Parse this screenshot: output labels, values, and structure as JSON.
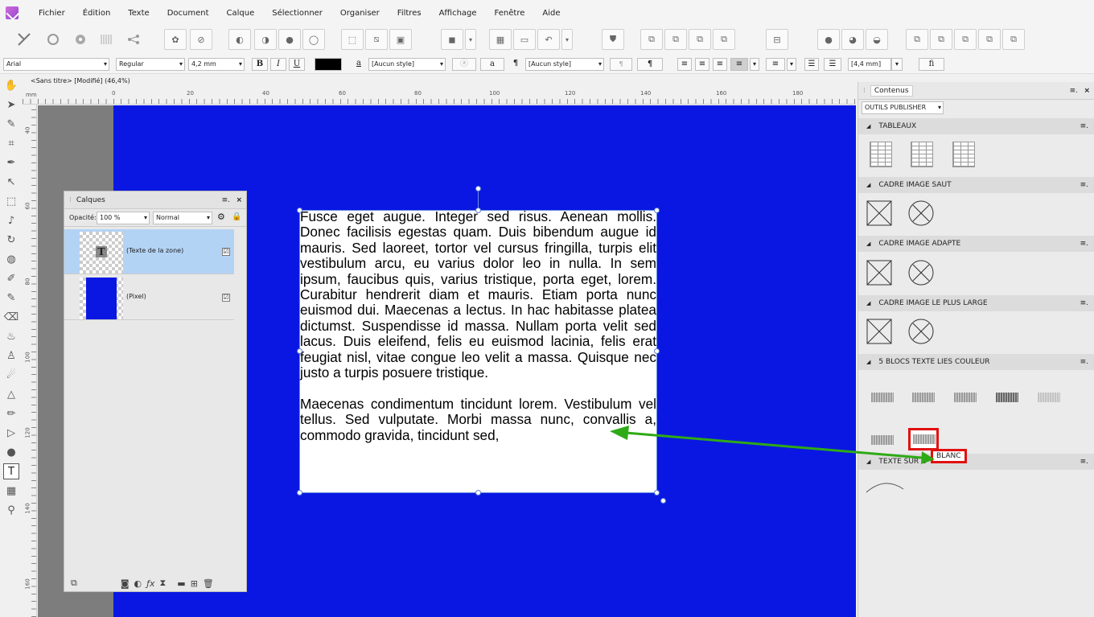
{
  "menu": [
    "Fichier",
    "Édition",
    "Texte",
    "Document",
    "Calque",
    "Sélectionner",
    "Organiser",
    "Filtres",
    "Affichage",
    "Fenêtre",
    "Aide"
  ],
  "context": {
    "font_family": "Arial",
    "font_style": "Regular",
    "font_size": "4,2 mm",
    "bold": "B",
    "italic": "I",
    "underline": "U",
    "char_style_glyph": "a",
    "char_style": "[Aucun style]",
    "para_style_glyph": "¶",
    "para_style": "[Aucun style]",
    "spacing": "[4,4 mm]",
    "ligature": "fi",
    "text_color": "#000000"
  },
  "document": {
    "title": "<Sans titre> [Modifié] (46,4%)",
    "unit": "mm",
    "ruler_h": [
      "0",
      "20",
      "40",
      "60",
      "80",
      "100",
      "120",
      "140",
      "160",
      "180"
    ],
    "ruler_v": [
      "40",
      "60",
      "80",
      "100",
      "120",
      "140",
      "160"
    ],
    "canvas_color": "#0a17e2",
    "pasteboard_color": "#7d7d7d"
  },
  "textframe": {
    "p1": "Fusce eget augue. Integer sed risus. Aenean mollis. Donec facilisis egestas quam. Duis bibendum augue id mauris. Sed laoreet, tortor vel cursus fringilla, turpis elit vestibulum arcu, eu varius dolor leo in nulla. In sem ipsum, faucibus quis, varius tristique, porta eget, lorem. Curabitur hendrerit diam et mauris. Etiam porta nunc euismod dui. Maecenas a lectus. In hac habitasse platea dictumst. Suspendisse id massa. Nullam porta velit sed lacus. Duis eleifend, felis eu euismod lacinia, felis erat feugiat nisl, vitae congue leo velit a massa. Quisque nec justo a turpis posuere tristique.",
    "p2": "Maecenas condimentum tincidunt lorem. Vestibulum vel tellus. Sed vulputate. Morbi massa nunc, convallis a, commodo gravida, tincidunt sed,"
  },
  "layers_panel": {
    "title": "Calques",
    "opacity_label": "Opacité:",
    "opacity_value": "100 %",
    "blend_mode": "Normal",
    "layers": [
      {
        "name": "(Texte de la zone)",
        "checked": "☑",
        "selected": true
      },
      {
        "name": "(Pixel)",
        "checked": "☑",
        "selected": false
      }
    ],
    "selected_color": "#b3d3f5"
  },
  "contenus_panel": {
    "title": "Contenus",
    "category": "OUTILS PUBLISHER",
    "sections": [
      "TABLEAUX",
      "CADRE IMAGE SAUT",
      "CADRE IMAGE ADAPTE",
      "CADRE IMAGE LE PLUS LARGE",
      "5 BLOCS TEXTE LIES COULEUR",
      "TEXTE SUR C"
    ],
    "tooltip": "BLANC",
    "highlight_color": "#e11010",
    "arrow_color": "#2eaa16"
  }
}
